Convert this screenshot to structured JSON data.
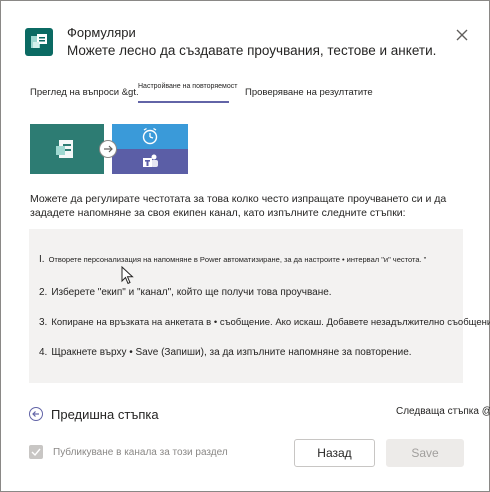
{
  "header": {
    "title": "Формуляри",
    "subtitle": "Можете лесно да създавате проучвания, тестове и анкети.",
    "app_icon": "forms-icon",
    "close_icon": "close-icon"
  },
  "tabs": [
    {
      "label": "Преглед на въпроси &gt."
    },
    {
      "label": "Настройване на повторяемост"
    },
    {
      "label": "Проверяване на резултатите"
    }
  ],
  "illustration": {
    "forms_icon": "forms-icon",
    "arrow_icon": "arrow-right-icon",
    "clock_icon": "alarm-clock-icon",
    "teams_icon": "teams-icon"
  },
  "description": "Можете да регулирате честотата за това колко често изпращате проучването си и да зададете напомняне за своя екипен канал, като изпълните следните стъпки:",
  "steps": [
    {
      "num": "I.",
      "text": "Отворете персонализация на напомняне в Power автоматизиране, за да настроите • интервал \"и\" честота. \""
    },
    {
      "num": "2.",
      "text": "Изберете \"екип\" и \"канал\", който ще получи това проучване."
    },
    {
      "num": "3.",
      "text": "Копиране на връзката на анкетата в • съобщение. Ако искаш. Добавете незадължително съобщение."
    },
    {
      "num": "4.",
      "text": "Щракнете върху • Save (Запиши), за да изпълните напомняне за повторение."
    }
  ],
  "navigation": {
    "prev_label": "Предишна стъпка",
    "next_label": "Следваща стъпка @"
  },
  "footer": {
    "checkbox_label": "Публикуване в канала за този раздел",
    "back_label": "Назад",
    "save_label": "Save"
  },
  "colors": {
    "accent": "#6264a7",
    "forms_green": "#2d7c73",
    "clock_blue": "#3a9ad9",
    "teams_purple": "#5b5ea6"
  }
}
